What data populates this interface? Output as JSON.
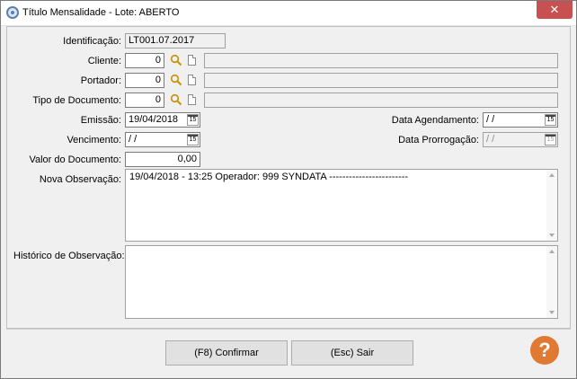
{
  "window": {
    "title": "Título Mensalidade - Lote: ABERTO",
    "close_glyph": "✕"
  },
  "form": {
    "identificacao": {
      "label": "Identificação:",
      "value": "LT001.07.2017"
    },
    "cliente": {
      "label": "Cliente:",
      "code": "0",
      "description": ""
    },
    "portador": {
      "label": "Portador:",
      "code": "0",
      "description": ""
    },
    "tipo_documento": {
      "label": "Tipo de Documento:",
      "code": "0",
      "description": ""
    },
    "emissao": {
      "label": "Emissão:",
      "value": "19/04/2018"
    },
    "vencimento": {
      "label": "Vencimento:",
      "value": " /  /"
    },
    "valor_documento": {
      "label": "Valor do Documento:",
      "value": "0,00"
    },
    "data_agendamento": {
      "label": "Data Agendamento:",
      "value": " /  /"
    },
    "data_prorrogacao": {
      "label": "Data Prorrogação:",
      "value": " /  /"
    },
    "nova_observacao": {
      "label": "Nova Observação:",
      "value": "19/04/2018 - 13:25 Operador: 999 SYNDATA ------------------------"
    },
    "historico_observacao": {
      "label": "Histórico de Observação:",
      "value": ""
    },
    "calendar_glyph": "15"
  },
  "buttons": {
    "confirm": "(F8) Confirmar",
    "exit": "(Esc) Sair",
    "help": "?"
  },
  "icons": {
    "app": "app-icon",
    "search": "search-icon",
    "new_document": "new-document-icon",
    "calendar": "calendar-icon",
    "help": "help-icon",
    "close": "close-icon"
  },
  "colors": {
    "help_button": "#e07a32",
    "close_button": "#c75050",
    "window_bg": "#f0f0f0"
  }
}
